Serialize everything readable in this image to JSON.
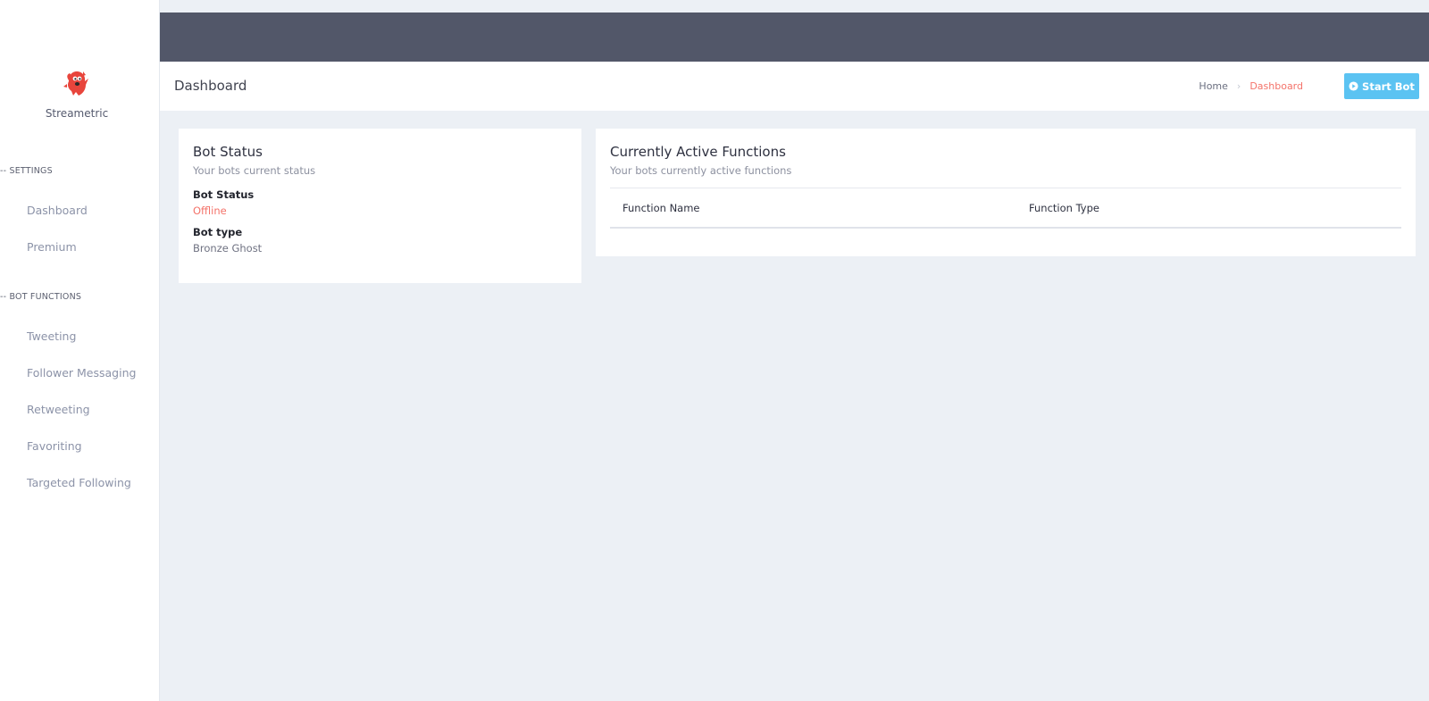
{
  "brand": {
    "name": "Streametric"
  },
  "sidebar": {
    "settings_title": "-- SETTINGS",
    "settings_items": [
      "Dashboard",
      "Premium"
    ],
    "functions_title": "-- BOT FUNCTIONS",
    "function_items": [
      "Tweeting",
      "Follower Messaging",
      "Retweeting",
      "Favoriting",
      "Targeted Following"
    ]
  },
  "header": {
    "title": "Dashboard",
    "breadcrumb": {
      "home": "Home",
      "current": "Dashboard"
    },
    "start_label": "Start Bot"
  },
  "bot_status_card": {
    "title": "Bot Status",
    "subtitle": "Your bots current status",
    "status_label": "Bot Status",
    "status_value": "Offline",
    "type_label": "Bot type",
    "type_value": "Bronze Ghost"
  },
  "functions_card": {
    "title": "Currently Active Functions",
    "subtitle": "Your bots currently active functions",
    "columns": [
      "Function Name",
      "Function Type"
    ]
  },
  "colors": {
    "topbar": "#525769",
    "accent_red": "#f4736a",
    "button_blue": "#5bc3f2"
  }
}
